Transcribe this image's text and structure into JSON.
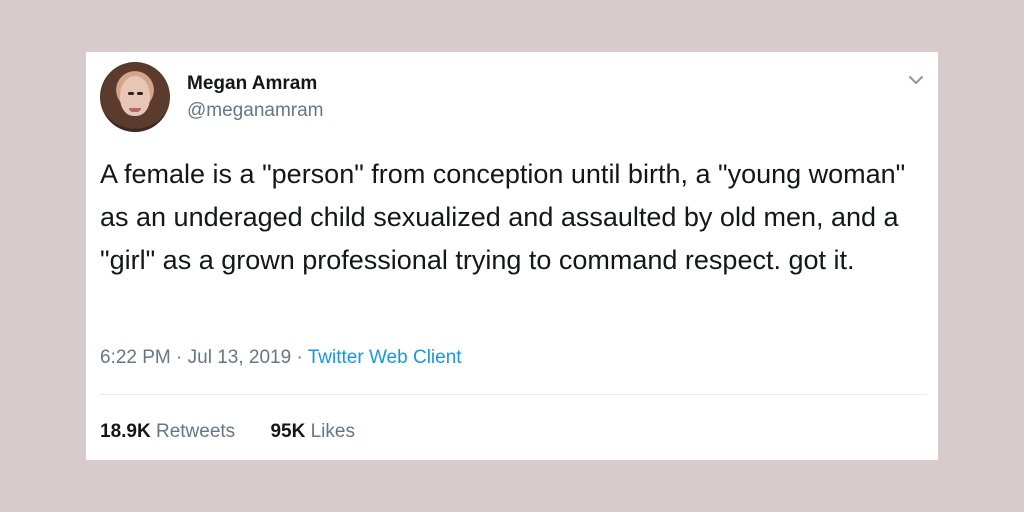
{
  "page": {
    "background_color": "#d8cbcb",
    "card_color": "#ffffff"
  },
  "tweet": {
    "author_name": "Megan Amram",
    "author_handle": "@meganamram",
    "text": "A female is a \"person\" from conception until birth, a \"young woman\" as an underaged child sexualized and assaulted by old men, and a \"girl\" as a grown professional trying to command respect. got it.",
    "time": "6:22 PM",
    "separator": "·",
    "date": "Jul 13, 2019",
    "client": "Twitter Web Client",
    "retweets_count": "18.9K",
    "retweets_label": "Retweets",
    "likes_count": "95K",
    "likes_label": "Likes"
  },
  "icons": {
    "menu": "chevron-down-icon",
    "avatar": "profile-avatar"
  },
  "colors": {
    "primary_text": "#14171a",
    "secondary_text": "#657786",
    "link": "#1b95e0",
    "divider": "#e6ecf0"
  }
}
